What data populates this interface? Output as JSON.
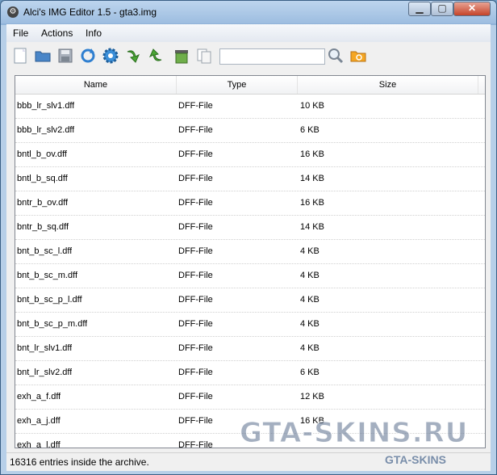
{
  "window": {
    "title": "Alci's IMG Editor 1.5 - gta3.img"
  },
  "menu": {
    "file": "File",
    "actions": "Actions",
    "info": "Info"
  },
  "search": {
    "value": ""
  },
  "table": {
    "headers": {
      "name": "Name",
      "type": "Type",
      "size": "Size"
    },
    "rows": [
      {
        "name": "bbb_lr_slv1.dff",
        "type": "DFF-File",
        "size": "10 KB"
      },
      {
        "name": "bbb_lr_slv2.dff",
        "type": "DFF-File",
        "size": "6 KB"
      },
      {
        "name": "bntl_b_ov.dff",
        "type": "DFF-File",
        "size": "16 KB"
      },
      {
        "name": "bntl_b_sq.dff",
        "type": "DFF-File",
        "size": "14 KB"
      },
      {
        "name": "bntr_b_ov.dff",
        "type": "DFF-File",
        "size": "16 KB"
      },
      {
        "name": "bntr_b_sq.dff",
        "type": "DFF-File",
        "size": "14 KB"
      },
      {
        "name": "bnt_b_sc_l.dff",
        "type": "DFF-File",
        "size": "4 KB"
      },
      {
        "name": "bnt_b_sc_m.dff",
        "type": "DFF-File",
        "size": "4 KB"
      },
      {
        "name": "bnt_b_sc_p_l.dff",
        "type": "DFF-File",
        "size": "4 KB"
      },
      {
        "name": "bnt_b_sc_p_m.dff",
        "type": "DFF-File",
        "size": "4 KB"
      },
      {
        "name": "bnt_lr_slv1.dff",
        "type": "DFF-File",
        "size": "4 KB"
      },
      {
        "name": "bnt_lr_slv2.dff",
        "type": "DFF-File",
        "size": "6 KB"
      },
      {
        "name": "exh_a_f.dff",
        "type": "DFF-File",
        "size": "12 KB"
      },
      {
        "name": "exh_a_j.dff",
        "type": "DFF-File",
        "size": "16 KB"
      },
      {
        "name": "exh_a_l.dff",
        "type": "DFF-File",
        "size": ""
      }
    ]
  },
  "status": {
    "text": "16316 entries inside the archive."
  },
  "watermark": {
    "main": "GTA-SKINS.RU",
    "sub": "GTA-SKINS"
  }
}
